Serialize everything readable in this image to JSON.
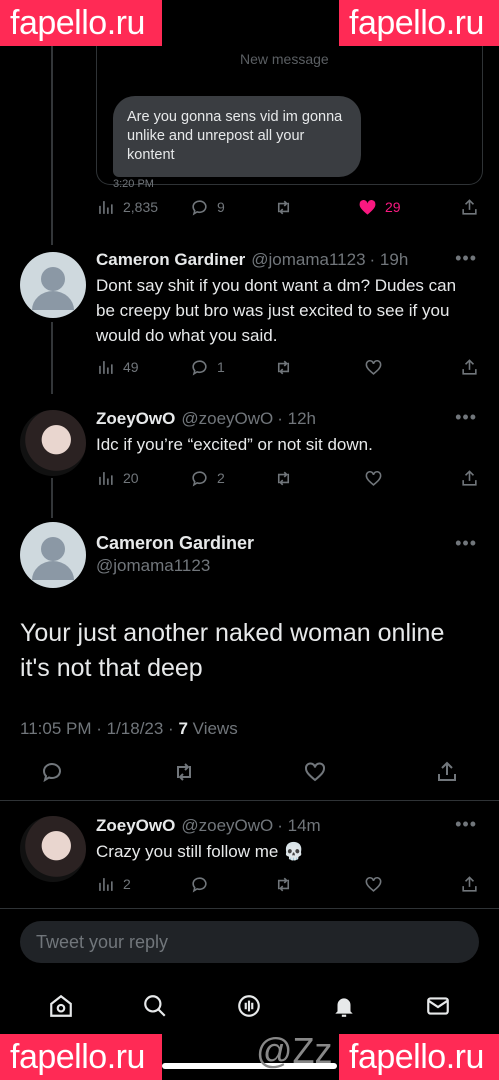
{
  "watermarks": {
    "site": "fapello.ru",
    "handle": "@Zz"
  },
  "faded_top": {
    "dm_label": "New message"
  },
  "dm_preview": {
    "text": "Are you gonna sens vid im gonna unlike and unrepost all your kontent",
    "time": "3:20 PM"
  },
  "top_actions": {
    "views": "2,835",
    "replies": "9",
    "likes": "29",
    "like_color": "#f91880"
  },
  "reply1": {
    "name": "Cameron Gardiner",
    "handle": "@jomama1123",
    "time": "· 19h",
    "text": "Dont say shit if you dont want a dm? Dudes can be creepy but bro was just excited to see if you would do what you said.",
    "views": "49",
    "replies": "1"
  },
  "reply2": {
    "name": "ZoeyOwO",
    "handle": "@zoeyOwO",
    "time": "· 12h",
    "text": "Idc if you’re “excited” or not sit down.",
    "views": "20",
    "replies": "2"
  },
  "main_tweet": {
    "name": "Cameron Gardiner",
    "handle": "@jomama1123",
    "text": "Your just another naked woman online it's not that deep",
    "datetime": "11:05 PM · 1/18/23 ·",
    "views_count": "7",
    "views_label": "Views"
  },
  "reply3": {
    "name": "ZoeyOwO",
    "handle": "@zoeyOwO",
    "time": "· 14m",
    "text": "Crazy you still follow me 💀",
    "views": "2"
  },
  "composer": {
    "placeholder": "Tweet your reply"
  },
  "more_glyph": "•••"
}
